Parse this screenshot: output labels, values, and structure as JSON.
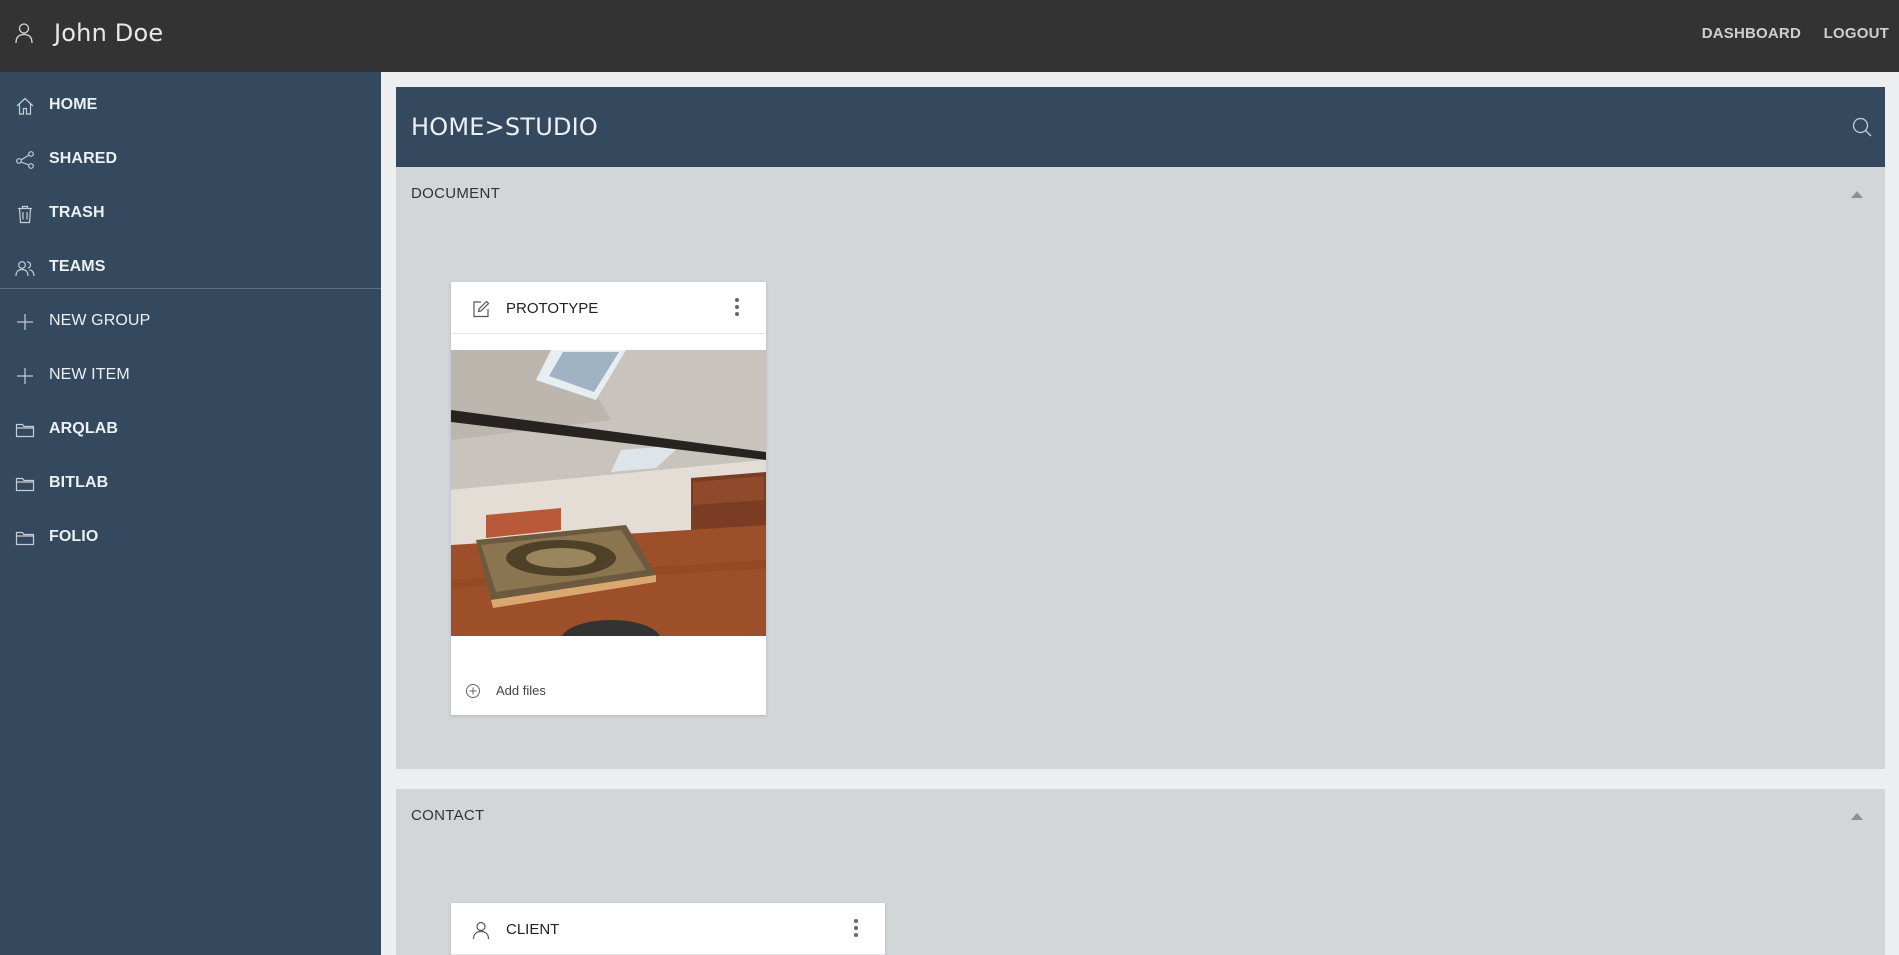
{
  "topbar": {
    "user_name": "John Doe",
    "dashboard_label": "DASHBOARD",
    "logout_label": "LOGOUT"
  },
  "sidebar": {
    "items": [
      {
        "label": "HOME",
        "icon": "home-icon"
      },
      {
        "label": "SHARED",
        "icon": "share-icon"
      },
      {
        "label": "TRASH",
        "icon": "trash-icon"
      },
      {
        "label": "TEAMS",
        "icon": "team-icon"
      },
      {
        "label": "NEW GROUP",
        "icon": "plus-icon"
      },
      {
        "label": "NEW ITEM",
        "icon": "plus-icon"
      },
      {
        "label": "ARQLAB",
        "icon": "folder-icon"
      },
      {
        "label": "BITLAB",
        "icon": "folder-icon"
      },
      {
        "label": "FOLIO",
        "icon": "folder-icon"
      }
    ]
  },
  "main": {
    "breadcrumb": "HOME>STUDIO",
    "sections": [
      {
        "title": "DOCUMENT",
        "card": {
          "title": "PROTOTYPE",
          "icon": "edit-icon",
          "add_files_label": "Add files"
        }
      },
      {
        "title": "CONTACT",
        "card": {
          "title": "CLIENT",
          "icon": "user-icon"
        }
      }
    ]
  },
  "colors": {
    "topbar": "#333333",
    "sidebar": "#34495e",
    "section_bg": "#d2d6d8",
    "page_bg": "#eceeef"
  }
}
